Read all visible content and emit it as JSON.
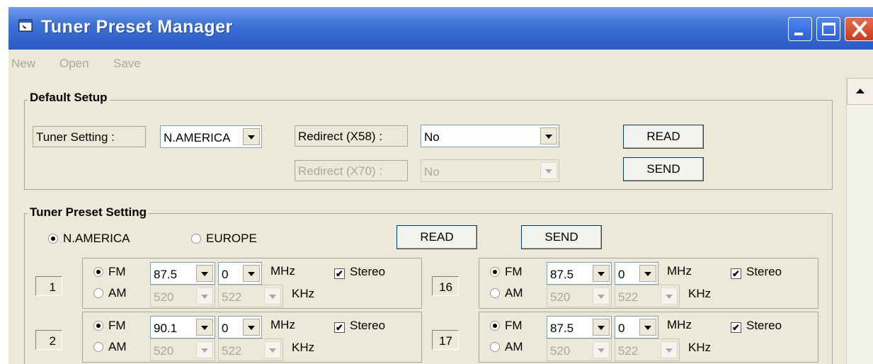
{
  "window": {
    "title": "Tuner Preset Manager"
  },
  "menu": {
    "items": [
      "New",
      "Open",
      "Save"
    ]
  },
  "default_setup": {
    "legend": "Default Setup",
    "tuner_label": "Tuner Setting :",
    "tuner_value": "N.AMERICA",
    "redirect58_label": "Redirect (X58) :",
    "redirect58_value": "No",
    "redirect70_label": "Redirect (X70) :",
    "redirect70_value": "No",
    "read_label": "READ",
    "send_label": "SEND"
  },
  "preset": {
    "legend": "Tuner Preset Setting",
    "region_na": "N.AMERICA",
    "region_eu": "EUROPE",
    "read_label": "READ",
    "send_label": "SEND",
    "fm_label": "FM",
    "am_label": "AM",
    "mhz": "MHz",
    "khz": "KHz",
    "stereo_label": "Stereo",
    "rows": [
      {
        "num": "1",
        "fm": "87.5",
        "fm2": "0",
        "am": "520",
        "am2": "522"
      },
      {
        "num": "16",
        "fm": "87.5",
        "fm2": "0",
        "am": "520",
        "am2": "522"
      },
      {
        "num": "2",
        "fm": "90.1",
        "fm2": "0",
        "am": "520",
        "am2": "522"
      },
      {
        "num": "17",
        "fm": "87.5",
        "fm2": "0",
        "am": "520",
        "am2": "522"
      }
    ]
  },
  "colors": {
    "titlebar": "#3466cf",
    "window_bg": "#ece9d8",
    "close_button": "#c53d1c"
  }
}
